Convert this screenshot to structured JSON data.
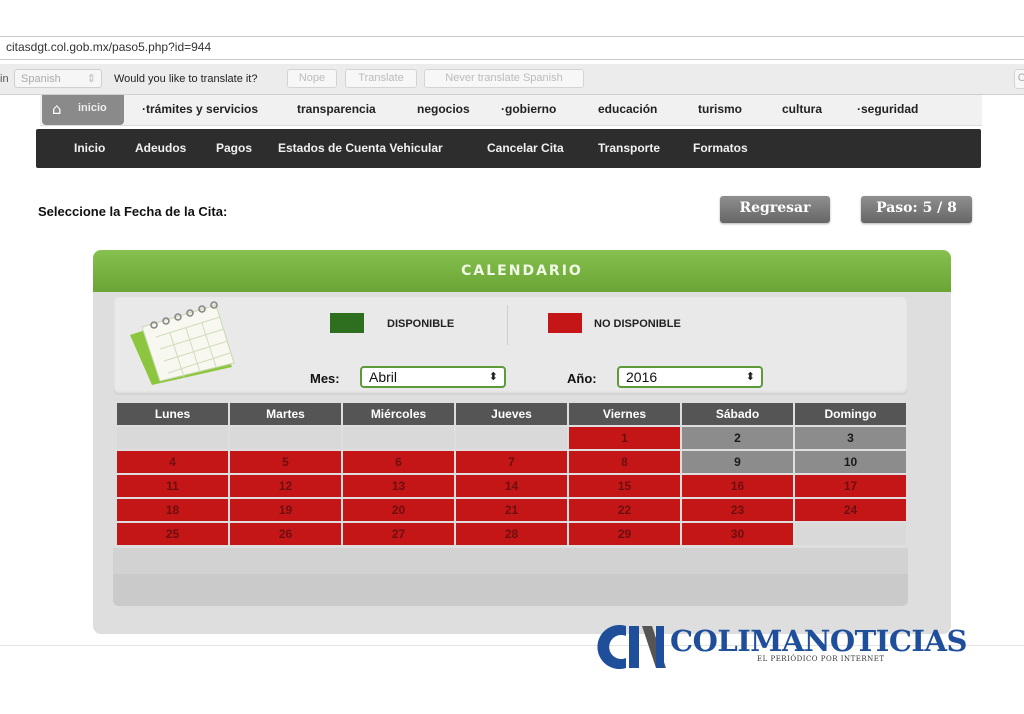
{
  "browser": {
    "url": "citasdgt.col.gob.mx/paso5.php?id=944",
    "translate_bar": {
      "in_label": "in",
      "language": "Spanish",
      "question": "Would you like to translate it?",
      "nope": "Nope",
      "translate": "Translate",
      "never": "Never translate Spanish",
      "close": "O"
    }
  },
  "top_nav": {
    "home_label": "inicio",
    "items": [
      "·trámites y servicios",
      "transparencia",
      "negocios",
      "·gobierno",
      "educación",
      "turismo",
      "cultura",
      "·seguridad"
    ]
  },
  "sub_nav": {
    "items": [
      "Inicio",
      "Adeudos",
      "Pagos",
      "Estados de Cuenta Vehicular",
      "Cancelar Cita",
      "Transporte",
      "Formatos"
    ]
  },
  "page": {
    "prompt": "Seleccione la Fecha de la Cita:",
    "back_button": "Regresar",
    "step_badge": "Paso: 5 / 8"
  },
  "calendar": {
    "header": "CALENDARIO",
    "legend": {
      "available": "DISPONIBLE",
      "unavailable": "NO DISPONIBLE",
      "available_color": "#2e6e1f",
      "unavailable_color": "#c41616"
    },
    "month_label": "Mes:",
    "month_value": "Abril",
    "year_label": "Año:",
    "year_value": "2016",
    "weekdays": [
      "Lunes",
      "Martes",
      "Miércoles",
      "Jueves",
      "Viernes",
      "Sábado",
      "Domingo"
    ],
    "weeks": [
      [
        null,
        null,
        null,
        null,
        {
          "d": "1",
          "s": "red"
        },
        {
          "d": "2",
          "s": "gray"
        },
        {
          "d": "3",
          "s": "gray"
        }
      ],
      [
        {
          "d": "4",
          "s": "red"
        },
        {
          "d": "5",
          "s": "red"
        },
        {
          "d": "6",
          "s": "red"
        },
        {
          "d": "7",
          "s": "red"
        },
        {
          "d": "8",
          "s": "red"
        },
        {
          "d": "9",
          "s": "gray"
        },
        {
          "d": "10",
          "s": "gray"
        }
      ],
      [
        {
          "d": "11",
          "s": "red"
        },
        {
          "d": "12",
          "s": "red"
        },
        {
          "d": "13",
          "s": "red"
        },
        {
          "d": "14",
          "s": "red"
        },
        {
          "d": "15",
          "s": "red"
        },
        {
          "d": "16",
          "s": "red"
        },
        {
          "d": "17",
          "s": "red"
        }
      ],
      [
        {
          "d": "18",
          "s": "red"
        },
        {
          "d": "19",
          "s": "red"
        },
        {
          "d": "20",
          "s": "red"
        },
        {
          "d": "21",
          "s": "red"
        },
        {
          "d": "22",
          "s": "red"
        },
        {
          "d": "23",
          "s": "red"
        },
        {
          "d": "24",
          "s": "red"
        }
      ],
      [
        {
          "d": "25",
          "s": "red"
        },
        {
          "d": "26",
          "s": "red"
        },
        {
          "d": "27",
          "s": "red"
        },
        {
          "d": "28",
          "s": "red"
        },
        {
          "d": "29",
          "s": "red"
        },
        {
          "d": "30",
          "s": "red"
        },
        null
      ]
    ]
  },
  "watermark": {
    "brand": "COLIMANOTICIAS",
    "tagline": "EL PERIÓDICO POR INTERNET",
    "icon": "cn-logo-icon"
  }
}
